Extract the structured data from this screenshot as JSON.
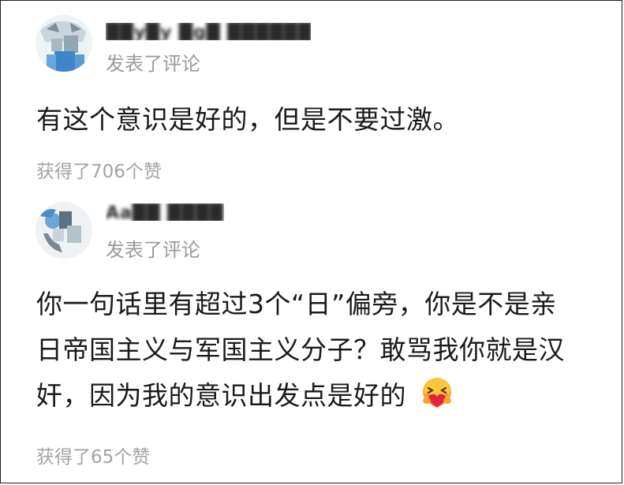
{
  "comments": [
    {
      "username": "██y█y █g█ ██████ysisie",
      "action": "发表了评论",
      "text_lines": [
        "有这个意识是好的，但是不要过激。"
      ],
      "likes": "获得了706个赞"
    },
    {
      "username": "Aa██ ████ █ l",
      "action": "发表了评论",
      "text_lines": [
        "你一句话里有超过3个“日”偏旁，你是不是亲",
        "日帝国主义与军国主义分子？敢骂我你就是汉",
        "奸，因为我的意识出发点是好的"
      ],
      "emoji": "hugging-heart-emoji",
      "likes": "获得了65个赞"
    }
  ],
  "colors": {
    "text": "#1a1a1a",
    "meta": "#9a9a9a",
    "border": "#222222",
    "emoji_face": "#f7b12a",
    "emoji_heart": "#e8203a"
  }
}
